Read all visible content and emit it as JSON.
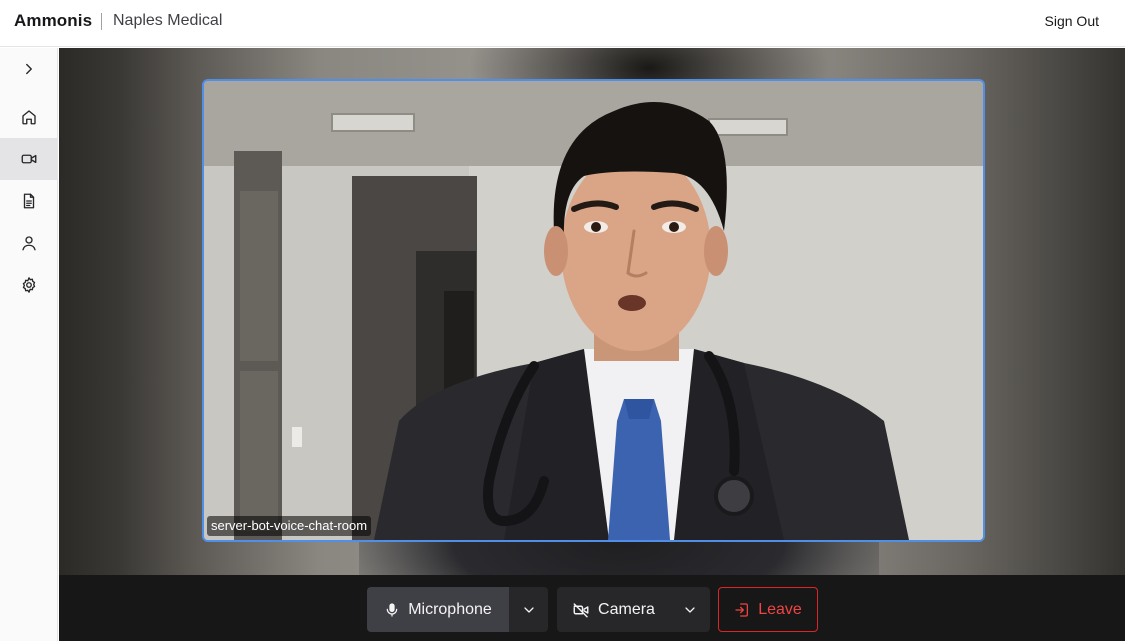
{
  "header": {
    "brand": "Ammonis",
    "organization": "Naples Medical",
    "sign_out_label": "Sign Out"
  },
  "sidebar": {
    "items": [
      {
        "icon": "chevron-right-icon",
        "active": false
      },
      {
        "icon": "home-icon",
        "active": false
      },
      {
        "icon": "video-camera-icon",
        "active": true
      },
      {
        "icon": "document-icon",
        "active": false
      },
      {
        "icon": "user-icon",
        "active": false
      },
      {
        "icon": "gear-icon",
        "active": false
      }
    ]
  },
  "video": {
    "participant_label": "server-bot-voice-chat-room",
    "tile_border_color": "#4f8fe8"
  },
  "controls": {
    "microphone_label": "Microphone",
    "camera_label": "Camera",
    "leave_label": "Leave",
    "leave_color": "#ef4444"
  }
}
